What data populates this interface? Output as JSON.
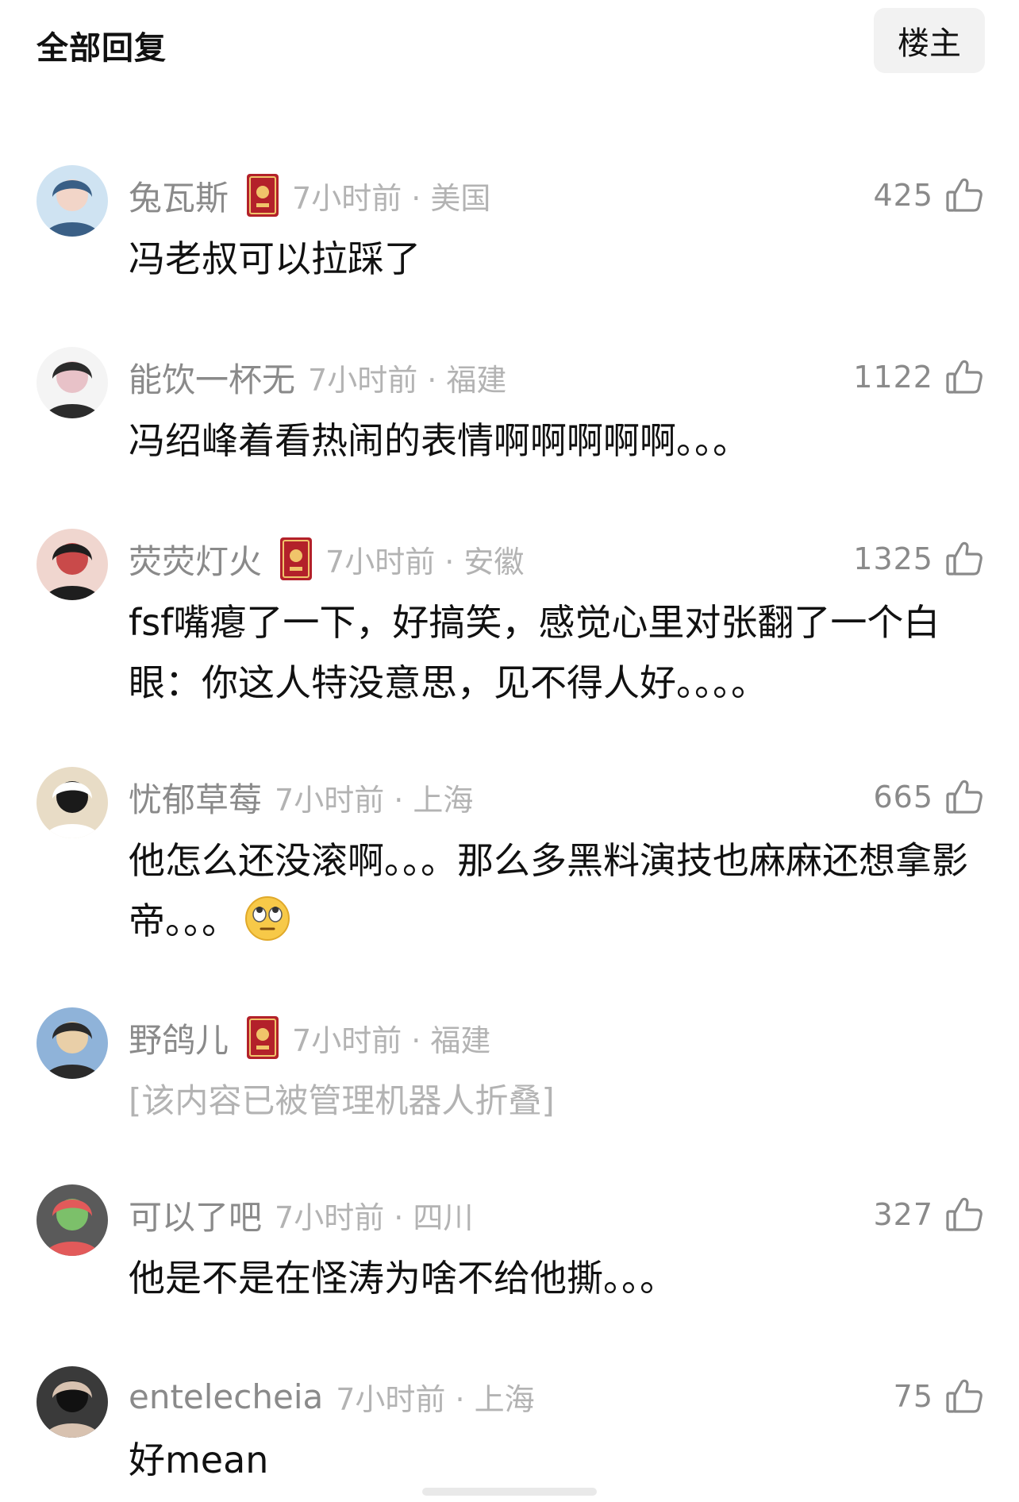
{
  "header": {
    "title": "全部回复",
    "op_button": "楼主"
  },
  "comments": [
    {
      "username": "兔瓦斯",
      "has_badge": true,
      "time_location": "7小时前 · 美国",
      "likes": "425",
      "text": "冯老叔可以拉踩了",
      "avatar_colors": [
        "#cfe3f2",
        "#3a5f86",
        "#f2d5c8"
      ]
    },
    {
      "username": "能饮一杯无",
      "has_badge": false,
      "time_location": "7小时前 · 福建",
      "likes": "1122",
      "text": "冯绍峰着看热闹的表情啊啊啊啊啊。。。",
      "avatar_colors": [
        "#f4f4f4",
        "#2b2b2b",
        "#e8c2c8"
      ]
    },
    {
      "username": "荧荧灯火",
      "has_badge": true,
      "time_location": "7小时前 · 安徽",
      "likes": "1325",
      "text": "fsf嘴瘪了一下，好搞笑，感觉心里对张翻了一个白眼：你这人特没意思，见不得人好。。。。",
      "avatar_colors": [
        "#f0d6cf",
        "#1e1e1e",
        "#c94a4a"
      ]
    },
    {
      "username": "忧郁草莓",
      "has_badge": false,
      "time_location": "7小时前 · 上海",
      "likes": "665",
      "text": "他怎么还没滚啊。。。那么多黑料演技也麻麻还想拿影帝。。。",
      "emoji": "eye-roll-emoji",
      "avatar_colors": [
        "#e8dcc6",
        "#ffffff",
        "#1a1a1a"
      ]
    },
    {
      "username": "野鸽儿",
      "has_badge": true,
      "time_location": "7小时前 · 福建",
      "likes": "",
      "text": "[该内容已被管理机器人折叠]",
      "folded": true,
      "avatar_colors": [
        "#8fb3d9",
        "#2a2a2a",
        "#e9cfa8"
      ]
    },
    {
      "username": "可以了吧",
      "has_badge": false,
      "time_location": "7小时前 · 四川",
      "likes": "327",
      "text": "他是不是在怪涛为啥不给他撕。。。",
      "avatar_colors": [
        "#5a5a5a",
        "#e25a5a",
        "#7cc06a"
      ]
    },
    {
      "username": "entelecheia",
      "has_badge": false,
      "time_location": "7小时前 · 上海",
      "likes": "75",
      "text": "好mean",
      "avatar_colors": [
        "#3a3a3a",
        "#d8c2b0",
        "#111111"
      ]
    }
  ]
}
